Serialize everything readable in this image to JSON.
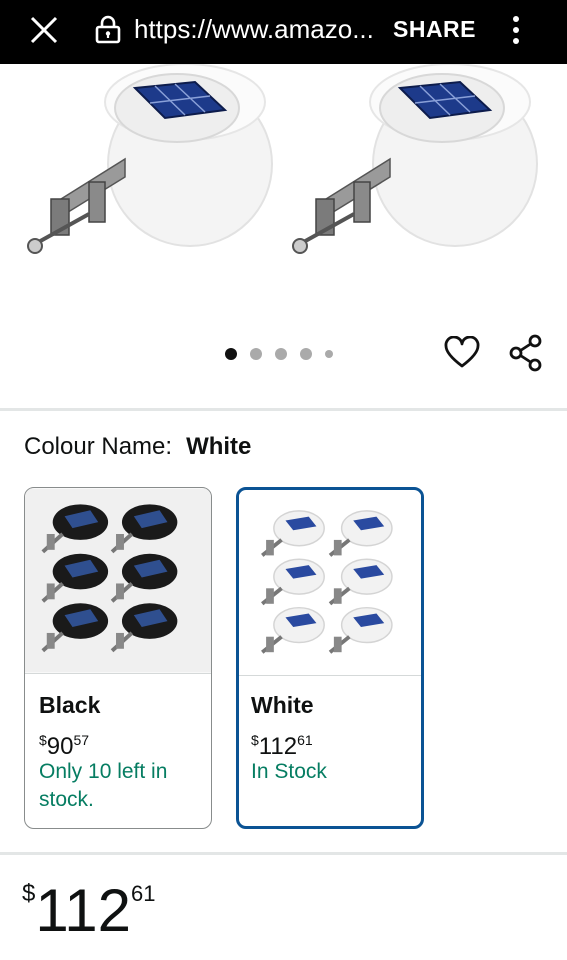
{
  "browser": {
    "url": "https://www.amazo...",
    "share_label": "SHARE",
    "icons": {
      "close": "close-icon",
      "lock": "lock-icon",
      "menu": "more-vertical-icon"
    }
  },
  "hero": {
    "image_count": 5,
    "active_index": 0,
    "icons": {
      "favorite": "heart-icon",
      "share": "share-icon"
    }
  },
  "colour": {
    "label": "Colour Name:",
    "selected": "White"
  },
  "options": [
    {
      "name": "Black",
      "currency": "$",
      "whole": "90",
      "cents": "57",
      "stock": "Only 10 left in stock.",
      "selected": false
    },
    {
      "name": "White",
      "currency": "$",
      "whole": "112",
      "cents": "61",
      "stock": "In Stock",
      "selected": true
    }
  ],
  "price": {
    "currency": "$",
    "whole": "112",
    "cents": "61"
  },
  "colors": {
    "stock_green": "#067d62",
    "selected_border": "#0b5394",
    "text": "#0f1111"
  }
}
